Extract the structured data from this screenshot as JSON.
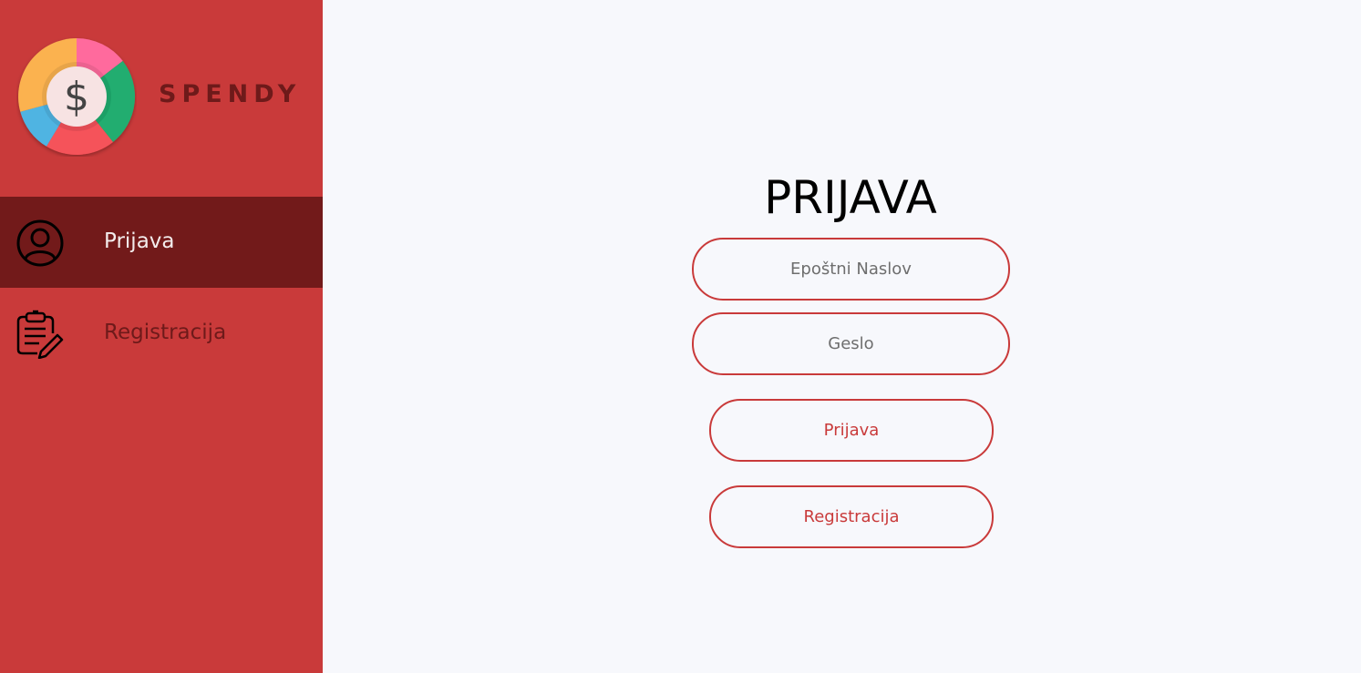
{
  "brand": {
    "name": "SPENDY",
    "logo_symbol": "$",
    "logo_icon": "dollar-wheel-logo"
  },
  "sidebar": {
    "items": [
      {
        "label": "Prijava",
        "icon": "user-circle-icon",
        "active": true
      },
      {
        "label": "Registracija",
        "icon": "clipboard-edit-icon",
        "active": false
      }
    ]
  },
  "main": {
    "title": "PRIJAVA",
    "email_placeholder": "Epoštni Naslov",
    "password_placeholder": "Geslo",
    "login_button": "Prijava",
    "register_button": "Registracija"
  },
  "colors": {
    "sidebar_bg": "#c93a3a",
    "sidebar_active_bg": "#721a1a",
    "brand_text": "#6e1a1a",
    "accent": "#c93a3a",
    "page_bg": "#f7f8fc"
  }
}
